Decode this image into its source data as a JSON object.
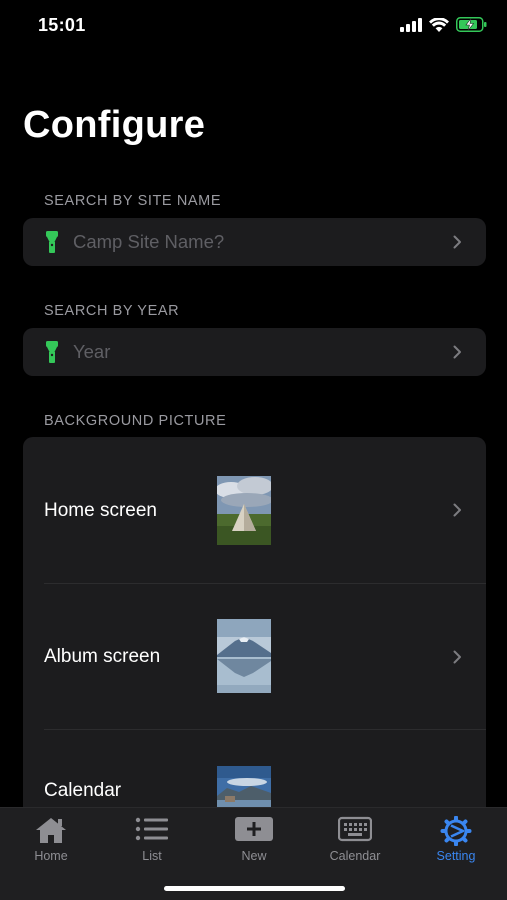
{
  "status_bar": {
    "time": "15:01",
    "battery_color": "#34c759"
  },
  "page": {
    "title": "Configure"
  },
  "search_site": {
    "header": "SEARCH BY SITE NAME",
    "placeholder": "Camp Site Name?"
  },
  "search_year": {
    "header": "SEARCH BY YEAR",
    "placeholder": "Year"
  },
  "background": {
    "header": "BACKGROUND PICTURE",
    "items": [
      {
        "label": "Home screen",
        "thumbnail": "tent-photo"
      },
      {
        "label": "Album screen",
        "thumbnail": "mountain-lake-photo"
      },
      {
        "label": "Calendar",
        "thumbnail": "lakeside-photo"
      }
    ]
  },
  "tab_bar": {
    "active_color": "#3a86f0",
    "tabs": [
      {
        "label": "Home",
        "icon": "house-icon"
      },
      {
        "label": "List",
        "icon": "list-icon"
      },
      {
        "label": "New",
        "icon": "plus-icon"
      },
      {
        "label": "Calendar",
        "icon": "keyboard-icon"
      },
      {
        "label": "Setting",
        "icon": "gear-icon",
        "active": true
      }
    ]
  },
  "accent_colors": {
    "flashlight": "#34c759",
    "tint": "#3a86f0"
  }
}
